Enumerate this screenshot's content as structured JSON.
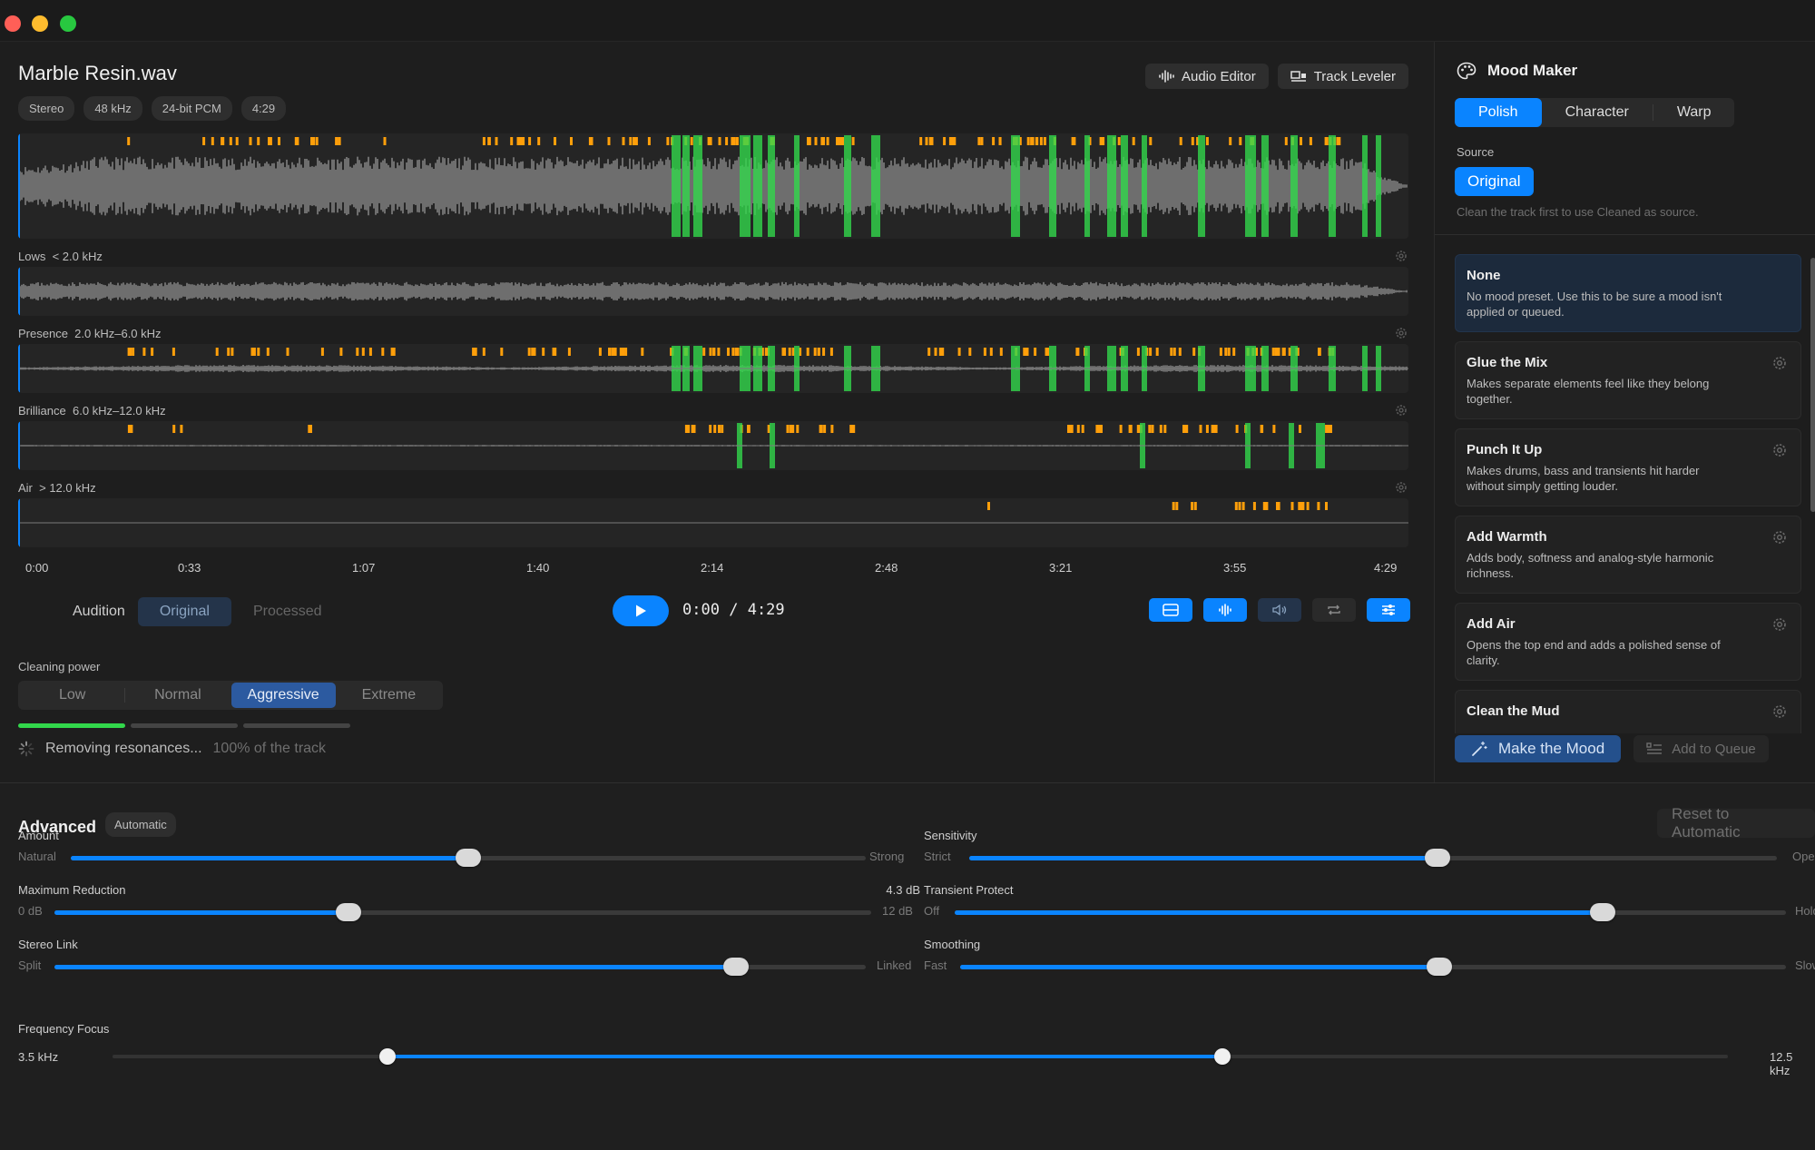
{
  "window": {
    "controls": [
      "close",
      "minimize",
      "zoom"
    ]
  },
  "file": {
    "name": "Marble Resin.wav",
    "chips": [
      "Stereo",
      "48 kHz",
      "24-bit PCM",
      "4:29"
    ]
  },
  "toolbar": {
    "audio_editor": "Audio Editor",
    "track_leveler": "Track Leveler"
  },
  "bands": [
    {
      "name": "Lows",
      "range": "< 2.0 kHz"
    },
    {
      "name": "Presence",
      "range": "2.0 kHz–6.0 kHz"
    },
    {
      "name": "Brilliance",
      "range": "6.0 kHz–12.0 kHz"
    },
    {
      "name": "Air",
      "range": "> 12.0 kHz"
    }
  ],
  "timeline": {
    "ticks": [
      "0:00",
      "0:33",
      "1:07",
      "1:40",
      "2:14",
      "2:48",
      "3:21",
      "3:55",
      "4:29"
    ],
    "duration_seconds": 269,
    "playhead_seconds": 0
  },
  "audition": {
    "label": "Audition",
    "options": [
      "Original",
      "Processed"
    ],
    "selected": "Original"
  },
  "transport": {
    "current": "0:00",
    "separator": "/",
    "total": "4:29"
  },
  "view_tools": [
    {
      "name": "layout-icon",
      "state": "on"
    },
    {
      "name": "waveform-icon",
      "state": "on"
    },
    {
      "name": "speaker-icon",
      "state": "dim"
    },
    {
      "name": "loop-icon",
      "state": "off"
    },
    {
      "name": "sliders-icon",
      "state": "on"
    }
  ],
  "cleaning": {
    "label": "Cleaning power",
    "options": [
      "Low",
      "Normal",
      "Aggressive",
      "Extreme"
    ],
    "selected": "Aggressive",
    "progress_steps_done": 1,
    "progress_steps_total": 3,
    "status": "Removing resonances...",
    "status_detail": "100% of the track"
  },
  "mood_maker": {
    "title": "Mood Maker",
    "tabs": [
      "Polish",
      "Character",
      "Warp"
    ],
    "selected_tab": "Polish",
    "source_label": "Source",
    "source_value": "Original",
    "source_note": "Clean the track first to use Cleaned as source.",
    "presets": [
      {
        "title": "None",
        "desc": "No mood preset. Use this to be sure a mood isn't applied or queued.",
        "selected": true
      },
      {
        "title": "Glue the Mix",
        "desc": "Makes separate elements feel like they belong together."
      },
      {
        "title": "Punch It Up",
        "desc": "Makes drums, bass and transients hit harder without simply getting louder."
      },
      {
        "title": "Add Warmth",
        "desc": "Adds body, softness and analog-style harmonic richness."
      },
      {
        "title": "Add Air",
        "desc": "Opens the top end and adds a polished sense of clarity."
      },
      {
        "title": "Clean the Mud",
        "desc": ""
      }
    ],
    "make_button": "Make the Mood",
    "queue_button": "Add to Queue"
  },
  "advanced": {
    "title": "Advanced",
    "badge": "Automatic",
    "reset": "Reset to Automatic",
    "sliders": [
      {
        "id": "amount",
        "label": "Amount",
        "min_label": "Natural",
        "max_label": "Strong",
        "value_text": "",
        "fraction": 0.5
      },
      {
        "id": "sensitivity",
        "label": "Sensitivity",
        "min_label": "Strict",
        "max_label": "Open",
        "value_text": "",
        "fraction": 0.58
      },
      {
        "id": "max-reduction",
        "label": "Maximum Reduction",
        "min_label": "0 dB",
        "max_label": "12 dB",
        "value_text": "4.3 dB",
        "fraction": 0.36
      },
      {
        "id": "transient",
        "label": "Transient Protect",
        "min_label": "Off",
        "max_label": "Hold",
        "value_text": "",
        "fraction": 0.78
      },
      {
        "id": "stereo-link",
        "label": "Stereo Link",
        "min_label": "Split",
        "max_label": "Linked",
        "value_text": "",
        "fraction": 0.84
      },
      {
        "id": "smoothing",
        "label": "Smoothing",
        "min_label": "Fast",
        "max_label": "Slow",
        "value_text": "",
        "fraction": 0.58
      }
    ],
    "frequency_focus": {
      "label": "Frequency Focus",
      "low": "3.5 kHz",
      "high": "12.5 kHz",
      "low_fraction": 0.17,
      "high_fraction": 0.687
    }
  },
  "colors": {
    "accent": "#0a84ff",
    "wave": "#8e8e8e",
    "marker_orange": "#ff9f0a",
    "marker_green": "#32d74b"
  }
}
